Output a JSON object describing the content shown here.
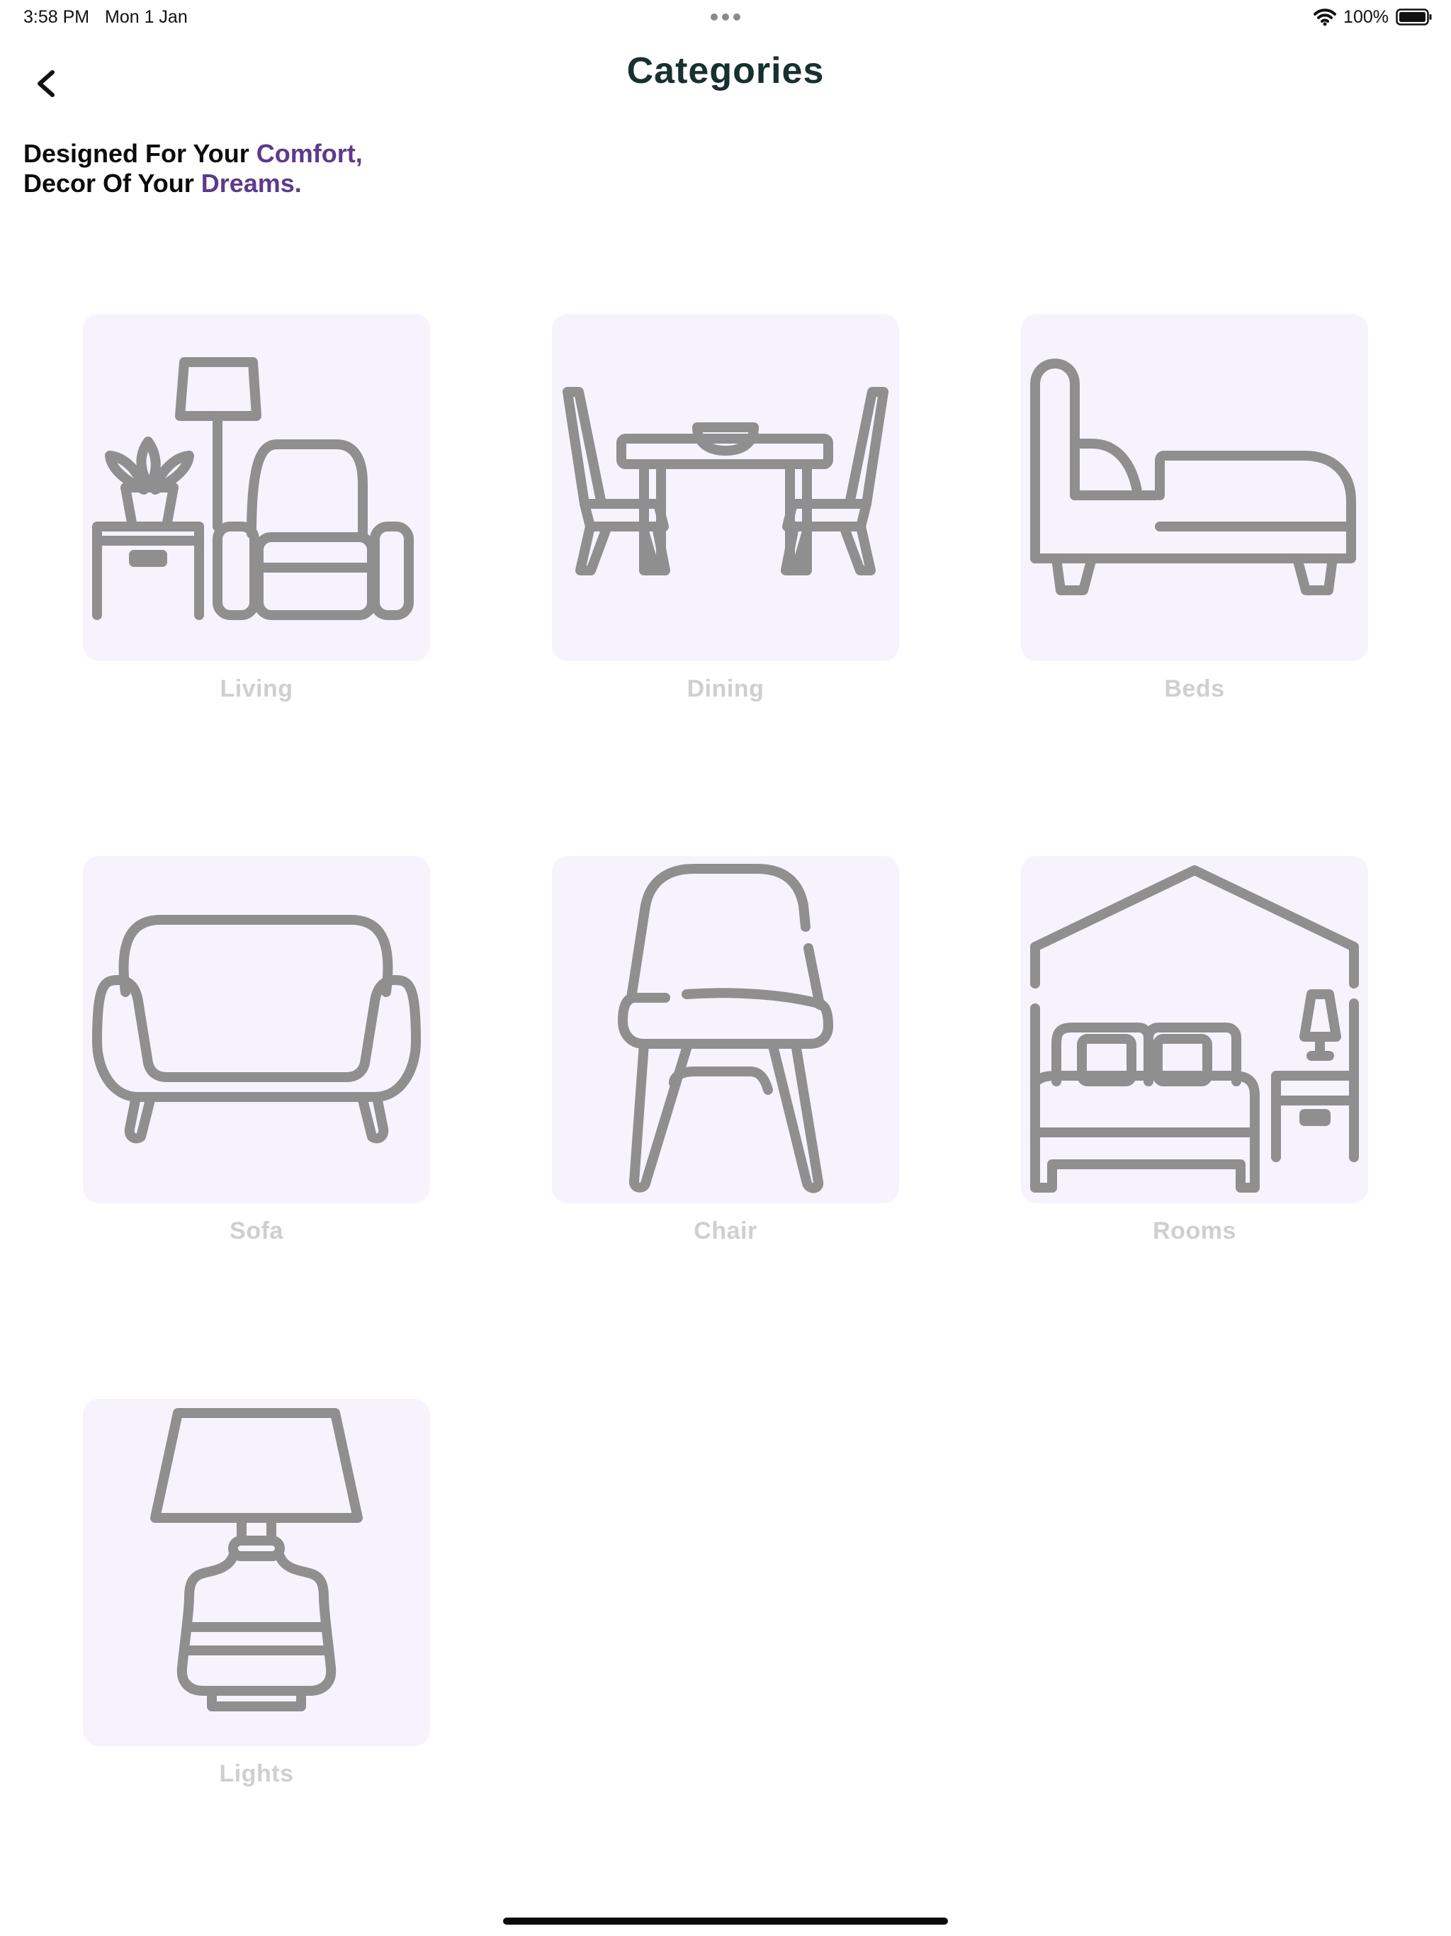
{
  "status_bar": {
    "time": "3:58 PM",
    "date": "Mon 1 Jan",
    "battery": "100%",
    "icons": [
      "multitask-dots-icon",
      "wifi-icon",
      "battery-icon"
    ]
  },
  "header": {
    "title": "Categories",
    "back_icon": "chevron-left-icon"
  },
  "tagline": {
    "line1_prefix": "Designed For Your ",
    "line1_accent": "Comfort,",
    "line2_prefix": "Decor Of Your ",
    "line2_accent": "Dreams."
  },
  "categories": [
    {
      "label": "Living",
      "icon": "living-room-icon"
    },
    {
      "label": "Dining",
      "icon": "dining-table-icon"
    },
    {
      "label": "Beds",
      "icon": "bed-icon"
    },
    {
      "label": "Sofa",
      "icon": "sofa-icon"
    },
    {
      "label": "Chair",
      "icon": "chair-icon"
    },
    {
      "label": "Rooms",
      "icon": "bedroom-house-icon"
    },
    {
      "label": "Lights",
      "icon": "table-lamp-icon"
    }
  ],
  "colors": {
    "accent": "#5d3a8c",
    "title": "#173030",
    "tile_background": "#f6f3fd",
    "icon_stroke": "#8f8f8f",
    "label": "#cfcfcf"
  }
}
